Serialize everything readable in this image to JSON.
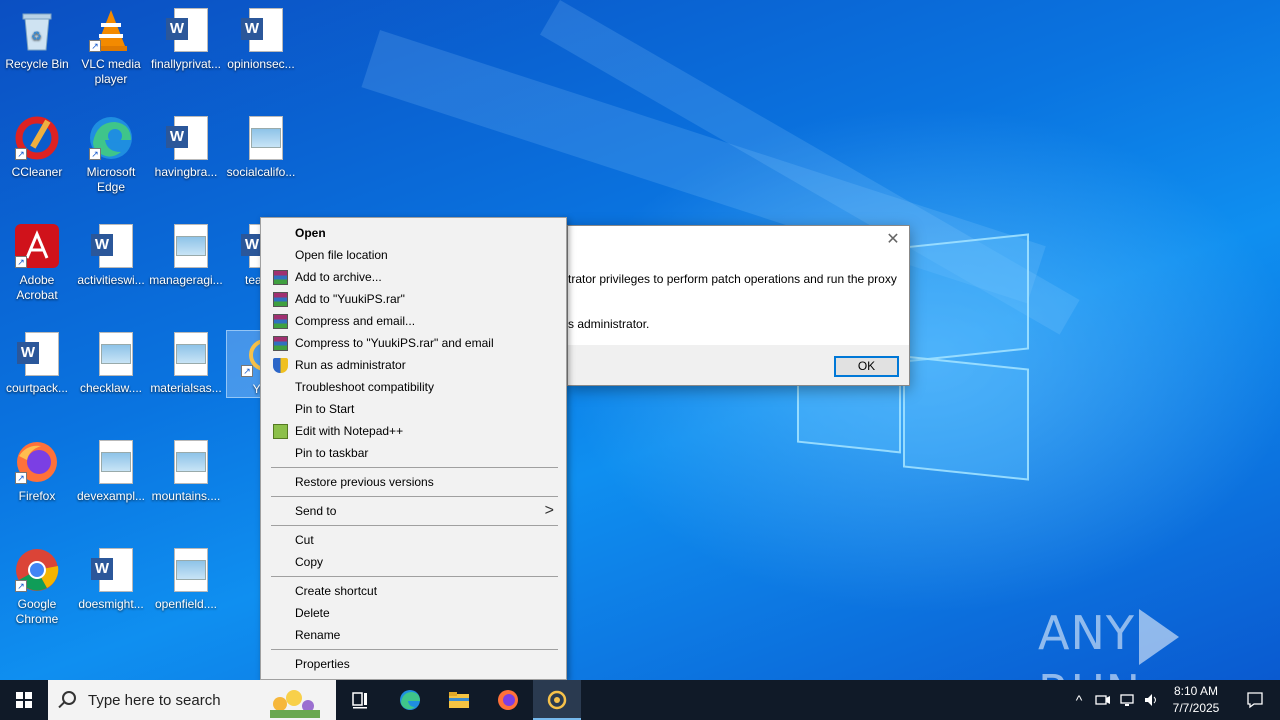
{
  "desktop": {
    "icons": [
      {
        "label": "Recycle Bin",
        "type": "recycle"
      },
      {
        "label": "VLC media player",
        "type": "vlc"
      },
      {
        "label": "finallyprivat...",
        "type": "word"
      },
      {
        "label": "opinionsec...",
        "type": "word"
      },
      {
        "label": "CCleaner",
        "type": "ccleaner"
      },
      {
        "label": "Microsoft Edge",
        "type": "edge"
      },
      {
        "label": "havingbra...",
        "type": "word"
      },
      {
        "label": "socialcalifo...",
        "type": "image"
      },
      {
        "label": "Adobe Acrobat",
        "type": "acrobat"
      },
      {
        "label": "activitieswi...",
        "type": "word"
      },
      {
        "label": "manageragi...",
        "type": "image"
      },
      {
        "label": "teachi",
        "type": "word"
      },
      {
        "label": "courtpack...",
        "type": "word"
      },
      {
        "label": "checklaw....",
        "type": "image"
      },
      {
        "label": "materialsas...",
        "type": "image"
      },
      {
        "label": "Yuu",
        "type": "yuuki"
      },
      {
        "label": "Firefox",
        "type": "firefox"
      },
      {
        "label": "devexampl...",
        "type": "image"
      },
      {
        "label": "mountains....",
        "type": "image"
      },
      {
        "label": "Google Chrome",
        "type": "chrome"
      },
      {
        "label": "doesmight...",
        "type": "word"
      },
      {
        "label": "openfield....",
        "type": "image"
      }
    ],
    "watermark": "ANY RUN"
  },
  "dialog": {
    "line1": "trator privileges to perform patch operations and run the proxy",
    "line2": "s administrator.",
    "ok_label": "OK",
    "close_glyph": "✕"
  },
  "context_menu": {
    "items": [
      {
        "label": "Open",
        "icon": ""
      },
      {
        "label": "Open file location",
        "icon": ""
      },
      {
        "label": "Add to archive...",
        "icon": "winrar"
      },
      {
        "label": "Add to \"YuukiPS.rar\"",
        "icon": "winrar"
      },
      {
        "label": "Compress and email...",
        "icon": "winrar"
      },
      {
        "label": "Compress to \"YuukiPS.rar\" and email",
        "icon": "winrar"
      },
      {
        "label": "Run as administrator",
        "icon": "uac-shield"
      },
      {
        "label": "Troubleshoot compatibility",
        "icon": ""
      },
      {
        "label": "Pin to Start",
        "icon": ""
      },
      {
        "label": "Edit with Notepad++",
        "icon": "notepadpp"
      },
      {
        "label": "Pin to taskbar",
        "icon": ""
      },
      {
        "label": "Restore previous versions",
        "icon": ""
      },
      {
        "label": "Send to",
        "icon": ""
      },
      {
        "label": "Cut",
        "icon": ""
      },
      {
        "label": "Copy",
        "icon": ""
      },
      {
        "label": "Create shortcut",
        "icon": ""
      },
      {
        "label": "Delete",
        "icon": ""
      },
      {
        "label": "Rename",
        "icon": ""
      },
      {
        "label": "Properties",
        "icon": ""
      }
    ],
    "submenu_arrow": ">"
  },
  "taskbar": {
    "search_placeholder": "Type here to search",
    "pinned": [
      "task-view",
      "edge",
      "file-explorer",
      "firefox",
      "yuukips"
    ],
    "tray_arrow": "^",
    "time": "8:10 AM",
    "date": "7/7/2025"
  },
  "colors": {
    "taskbar": "#101a28",
    "menu_bg": "#f2f2f2",
    "dialog_button_border": "#0078d7",
    "desktop_blue": "#0a74e0"
  }
}
